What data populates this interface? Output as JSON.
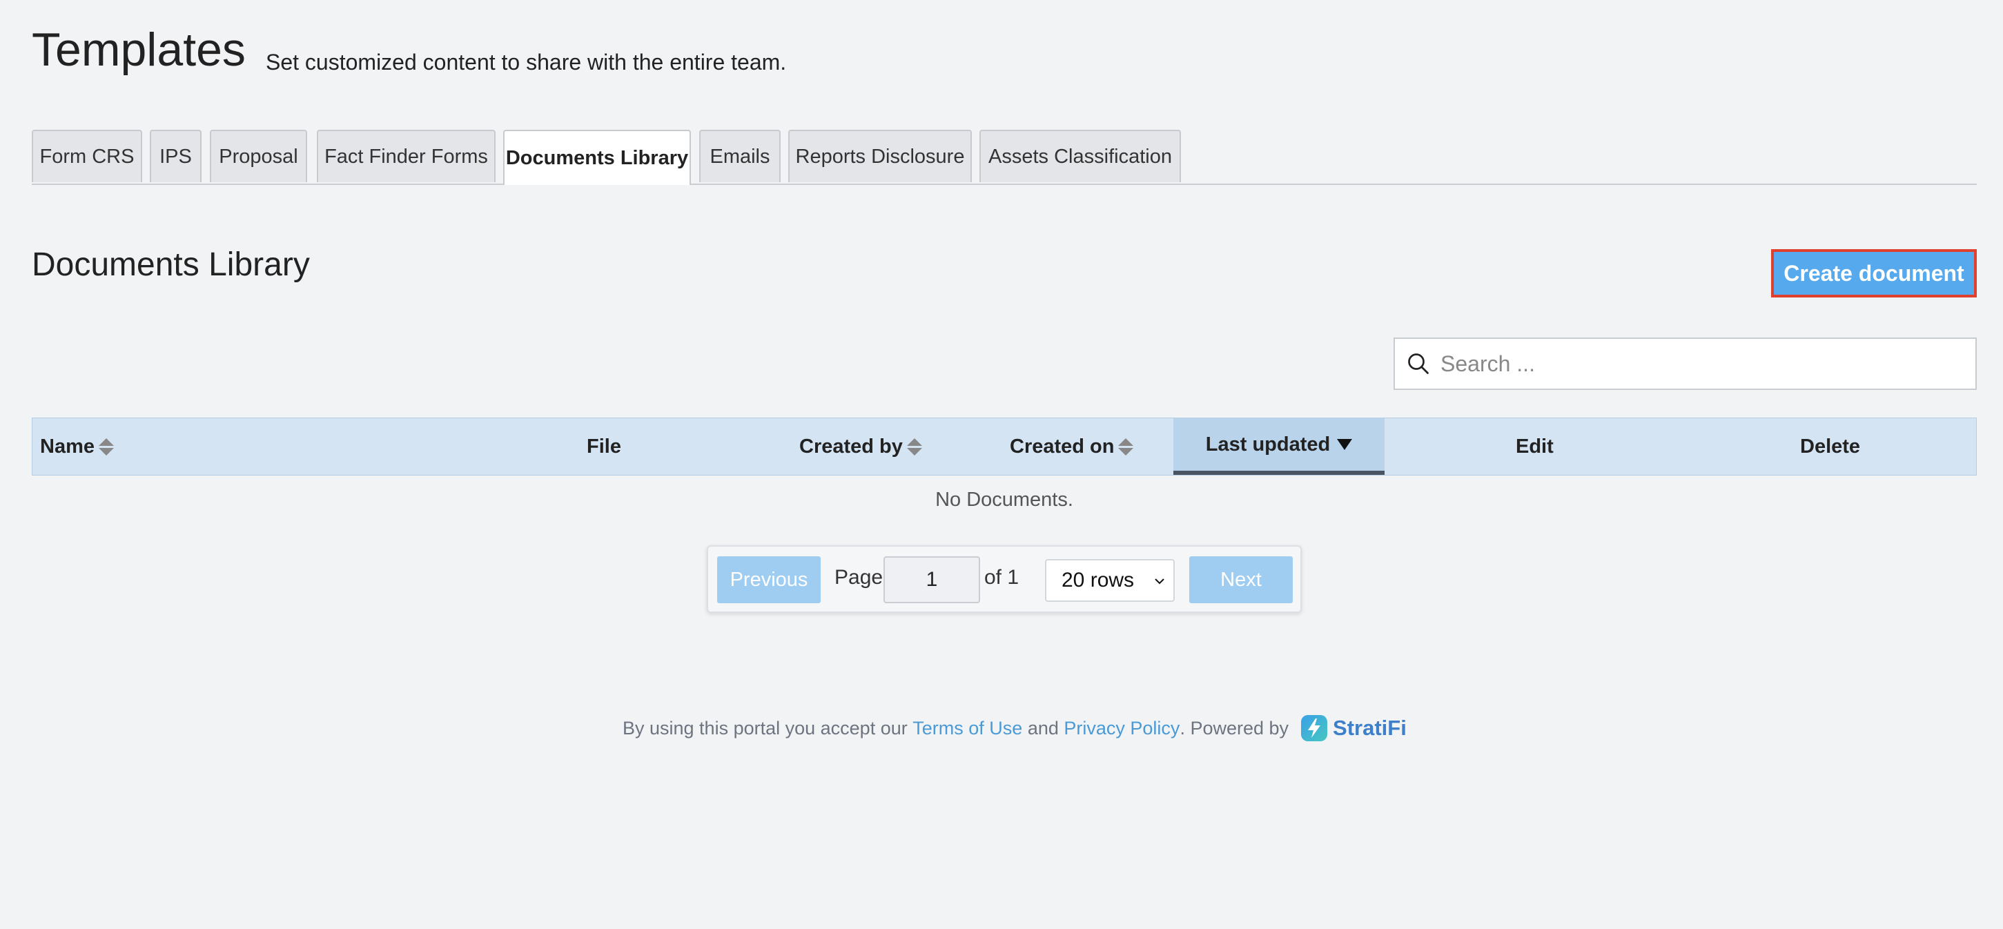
{
  "header": {
    "title": "Templates",
    "subtitle": "Set customized content to share with the entire team."
  },
  "tabs": [
    {
      "label": "Form CRS",
      "active": false
    },
    {
      "label": "IPS",
      "active": false
    },
    {
      "label": "Proposal",
      "active": false
    },
    {
      "label": "Fact Finder Forms",
      "active": false
    },
    {
      "label": "Documents Library",
      "active": true
    },
    {
      "label": "Emails",
      "active": false
    },
    {
      "label": "Reports Disclosure",
      "active": false
    },
    {
      "label": "Assets Classification",
      "active": false
    }
  ],
  "section": {
    "title": "Documents Library",
    "create_button": "Create document"
  },
  "search": {
    "placeholder": "Search ..."
  },
  "table": {
    "columns": [
      "Name",
      "File",
      "Created by",
      "Created on",
      "Last updated",
      "Edit",
      "Delete"
    ],
    "empty_message": "No Documents."
  },
  "pagination": {
    "previous": "Previous",
    "page_label": "Page",
    "page_value": "1",
    "of_label": "of 1",
    "rows_option": "20 rows",
    "next": "Next"
  },
  "footer": {
    "prefix": "By using this portal you accept our",
    "terms": "Terms of Use",
    "and": "and",
    "privacy": "Privacy Policy",
    "powered": ". Powered by",
    "brand": "StratiFi"
  },
  "colors": {
    "accent": "#56a9ec",
    "highlight_border": "#e0402e",
    "table_header": "#d4e4f3"
  }
}
